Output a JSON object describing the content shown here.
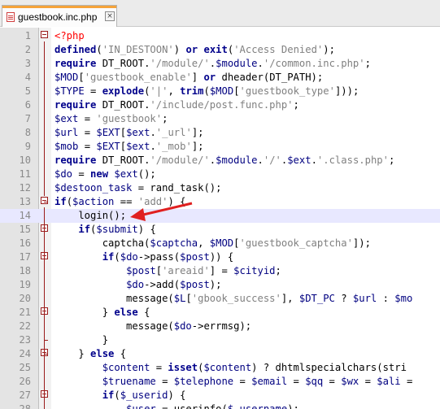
{
  "tab": {
    "label": "guestbook.inc.php",
    "close_glyph": "×",
    "file_icon": "file-icon",
    "close_icon": "close-icon"
  },
  "editor": {
    "current_line": 14,
    "lines": [
      {
        "n": "1",
        "text": "<?php"
      },
      {
        "n": "2",
        "text": "defined('IN_DESTOON') or exit('Access Denied');"
      },
      {
        "n": "3",
        "text": "require DT_ROOT.'/module/'.$module.'/common.inc.php';"
      },
      {
        "n": "4",
        "text": "$MOD['guestbook_enable'] or dheader(DT_PATH);"
      },
      {
        "n": "5",
        "text": "$TYPE = explode('|', trim($MOD['guestbook_type']));"
      },
      {
        "n": "6",
        "text": "require DT_ROOT.'/include/post.func.php';"
      },
      {
        "n": "7",
        "text": "$ext = 'guestbook';"
      },
      {
        "n": "8",
        "text": "$url = $EXT[$ext.'_url'];"
      },
      {
        "n": "9",
        "text": "$mob = $EXT[$ext.'_mob'];"
      },
      {
        "n": "10",
        "text": "require DT_ROOT.'/module/'.$module.'/'.$ext.'.class.php';"
      },
      {
        "n": "11",
        "text": "$do = new $ext();"
      },
      {
        "n": "12",
        "text": "$destoon_task = rand_task();"
      },
      {
        "n": "13",
        "text": "if($action == 'add') {"
      },
      {
        "n": "14",
        "text": "    login();"
      },
      {
        "n": "15",
        "text": "    if($submit) {"
      },
      {
        "n": "16",
        "text": "        captcha($captcha, $MOD['guestbook_captcha']);"
      },
      {
        "n": "17",
        "text": "        if($do->pass($post)) {"
      },
      {
        "n": "18",
        "text": "            $post['areaid'] = $cityid;"
      },
      {
        "n": "19",
        "text": "            $do->add($post);"
      },
      {
        "n": "20",
        "text": "            message($L['gbook_success'], $DT_PC ? $url : $mo"
      },
      {
        "n": "21",
        "text": "        } else {"
      },
      {
        "n": "22",
        "text": "            message($do->errmsg);"
      },
      {
        "n": "23",
        "text": "        }"
      },
      {
        "n": "24",
        "text": "    } else {"
      },
      {
        "n": "25",
        "text": "        $content = isset($content) ? dhtmlspecialchars(stri"
      },
      {
        "n": "26",
        "text": "        $truename = $telephone = $email = $qq = $wx = $ali ="
      },
      {
        "n": "27",
        "text": "        if($_userid) {"
      },
      {
        "n": "28",
        "text": "            $user = userinfo($_username);"
      }
    ]
  },
  "annotation": {
    "arrow_color": "#e02020",
    "points_to_line": 14
  },
  "colors": {
    "keyword": "#00008b",
    "string": "#808080",
    "variable": "#000080",
    "php_tag": "#ff0000",
    "fold_marker": "#9a1b1b",
    "tab_accent": "#f5a33a",
    "current_line": "#e8e8ff"
  }
}
